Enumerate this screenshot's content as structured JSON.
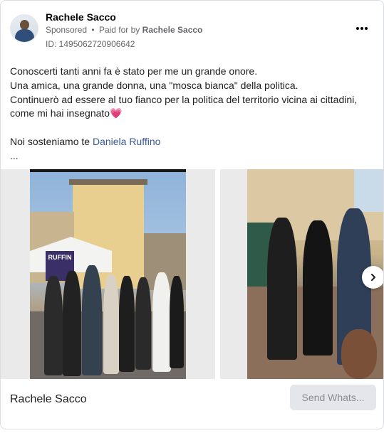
{
  "post": {
    "author": "Rachele Sacco",
    "sponsored_label": "Sponsored",
    "separator": "•",
    "paid_for_prefix": "Paid for by",
    "paid_for_by": "Rachele Sacco",
    "ad_id": "ID: 1495062720906642",
    "more_icon": "more-horizontal-icon"
  },
  "body": {
    "line1": "Conoscerti tanti anni fa è stato per me un grande onore.",
    "line2": "Una amica, una grande donna, una \"mosca bianca\" della politica.",
    "line3": "Continuerò ad essere al tuo fianco per la politica del territorio vicina ai cittadini,",
    "line4": "come mi hai insegnato",
    "heart": "💗",
    "line6_prefix": "Noi sosteniamo te ",
    "line6_link": "Daniela Ruffino",
    "ellipsis": "..."
  },
  "carousel": {
    "poster_text": "RUFFIN",
    "next_icon": "chevron-right-icon"
  },
  "footer": {
    "page_name": "Rachele Sacco",
    "cta_label": "Send Whats..."
  },
  "colors": {
    "link": "#385898",
    "meta": "#65676b",
    "cta_bg": "#e4e6eb"
  }
}
